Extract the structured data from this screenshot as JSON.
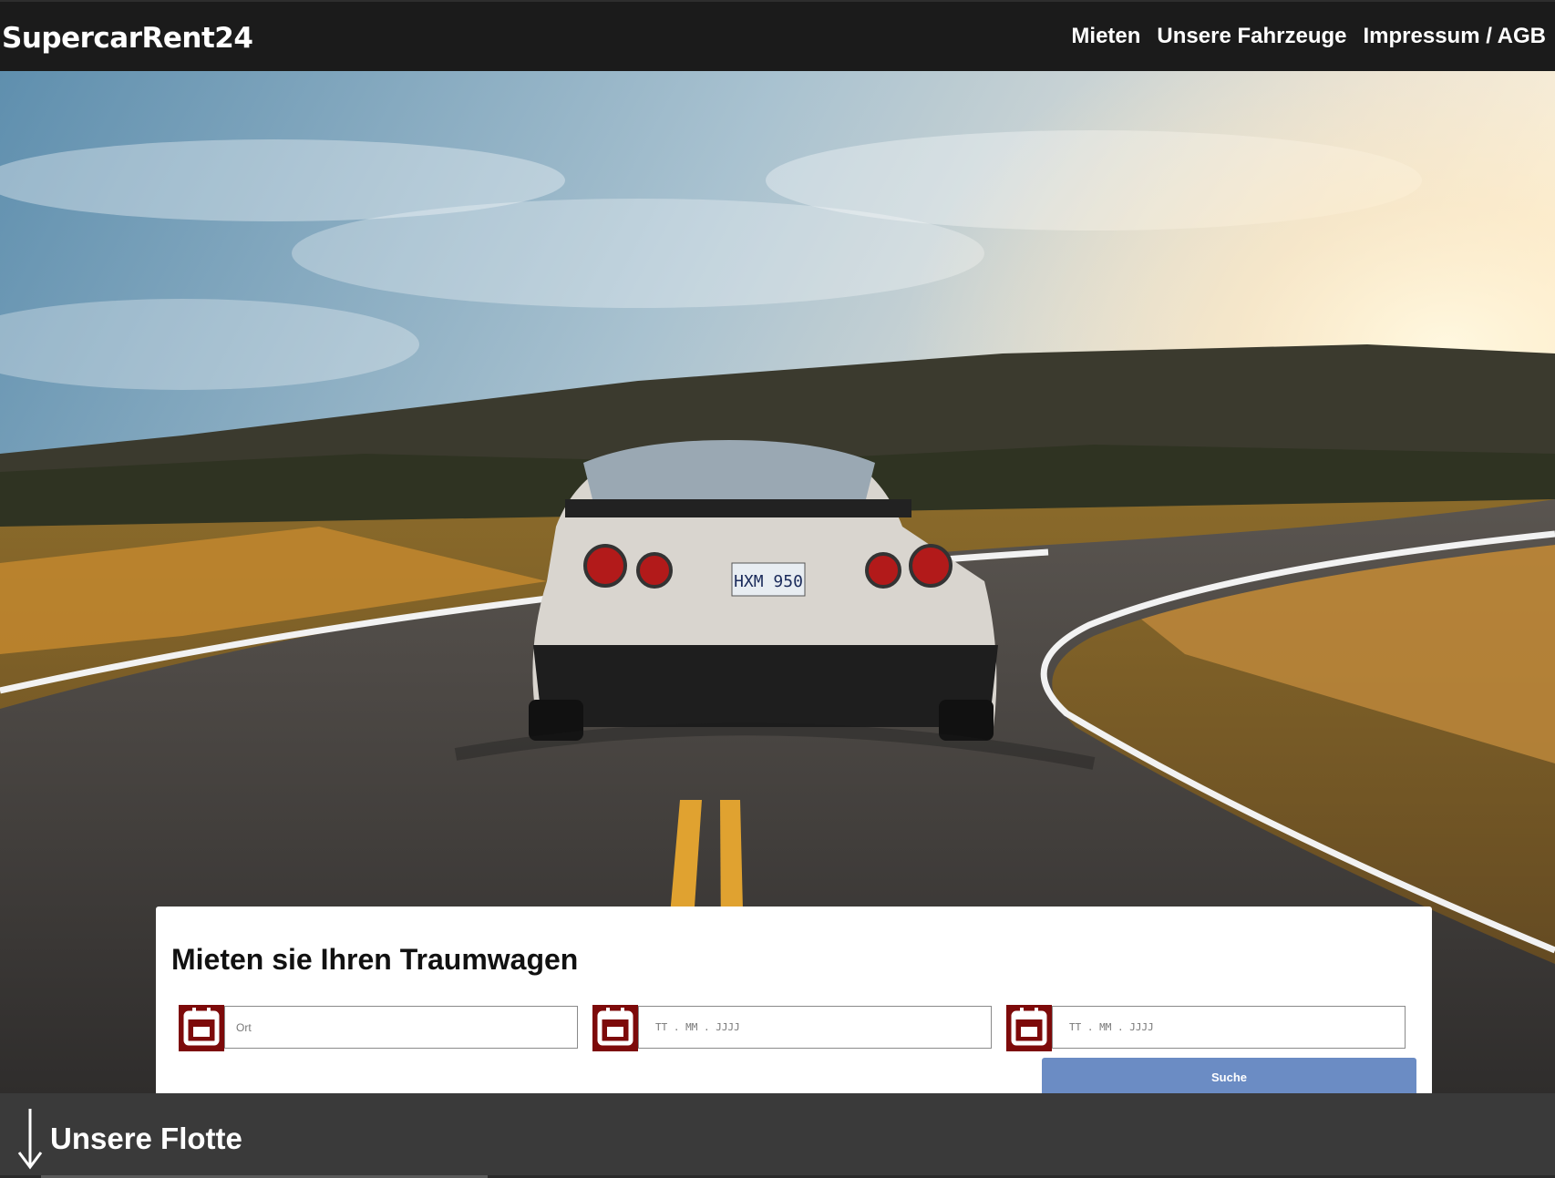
{
  "brand": "SupercarRent24",
  "nav": {
    "items": [
      "Mieten",
      "Unsere Fahrzeuge",
      "Impressum / AGB"
    ]
  },
  "hero": {
    "image": "sports-car-on-country-road-at-sunset",
    "plate": "HXM 950"
  },
  "search": {
    "title": "Mieten sie Ihren Traumwagen",
    "location_placeholder": "Ort",
    "start_date_placeholder": "TT . MM . JJJJ",
    "end_date_placeholder": "TT . MM . JJJJ",
    "button_label": "Suche"
  },
  "fleet": {
    "title": "Unsere Flotte"
  },
  "colors": {
    "navbar": "#1b1b1b",
    "icon_box": "#7d0a0a",
    "button": "#6b8cc4",
    "footer": "#3a3a3a"
  },
  "icons": {
    "field_icon": "calendar-icon",
    "scroll_icon": "arrow-down-icon"
  }
}
